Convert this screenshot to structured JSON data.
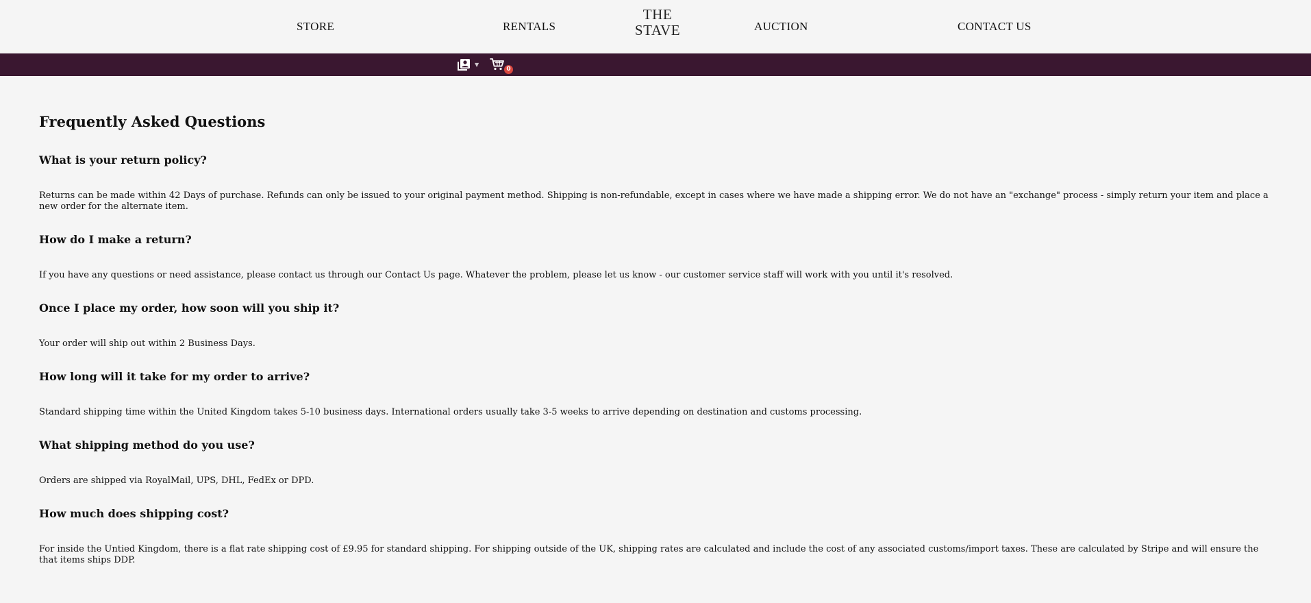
{
  "nav": {
    "store": "STORE",
    "rentals": "RENTALS",
    "logo_line1": "THE",
    "logo_line2": "STAVE",
    "auction": "AUCTION",
    "contact": "CONTACT US"
  },
  "toolbar": {
    "account_icon": "account-icon",
    "cart_icon": "cart-icon",
    "cart_count": "0"
  },
  "colors": {
    "toolbar_bg": "#3a1730",
    "page_bg": "#f5f5f5",
    "badge": "#d9473f"
  },
  "faq": {
    "title": "Frequently Asked Questions",
    "items": [
      {
        "question": "What is your return policy?",
        "answer": "Returns can be made within 42 Days of purchase. Refunds can only be issued to your original payment method. Shipping is non-refundable, except in cases where we have made a shipping error. We do not have an \"exchange\" process - simply return your item and place a new order for the alternate item."
      },
      {
        "question": "How do I make a return?",
        "answer": "If you have any questions or need assistance, please contact us through our Contact Us page. Whatever the problem, please let us know - our customer service staff will work with you until it's resolved."
      },
      {
        "question": "Once I place my order, how soon will you ship it?",
        "answer": "Your order will ship out within 2 Business Days."
      },
      {
        "question": "How long will it take for my order to arrive?",
        "answer": "Standard shipping time within the United Kingdom takes 5-10 business days. International orders usually take 3-5 weeks to arrive depending on destination and customs processing."
      },
      {
        "question": "What shipping method do you use?",
        "answer": "Orders are shipped via RoyalMail, UPS, DHL, FedEx or DPD."
      },
      {
        "question": "How much does shipping cost?",
        "answer": "For inside the Untied Kingdom, there is a flat rate shipping cost of £9.95 for standard shipping. For shipping outside of the UK, shipping rates are calculated and include the cost of any associated customs/import taxes. These are calculated by Stripe and will ensure the that items ships DDP."
      }
    ]
  }
}
